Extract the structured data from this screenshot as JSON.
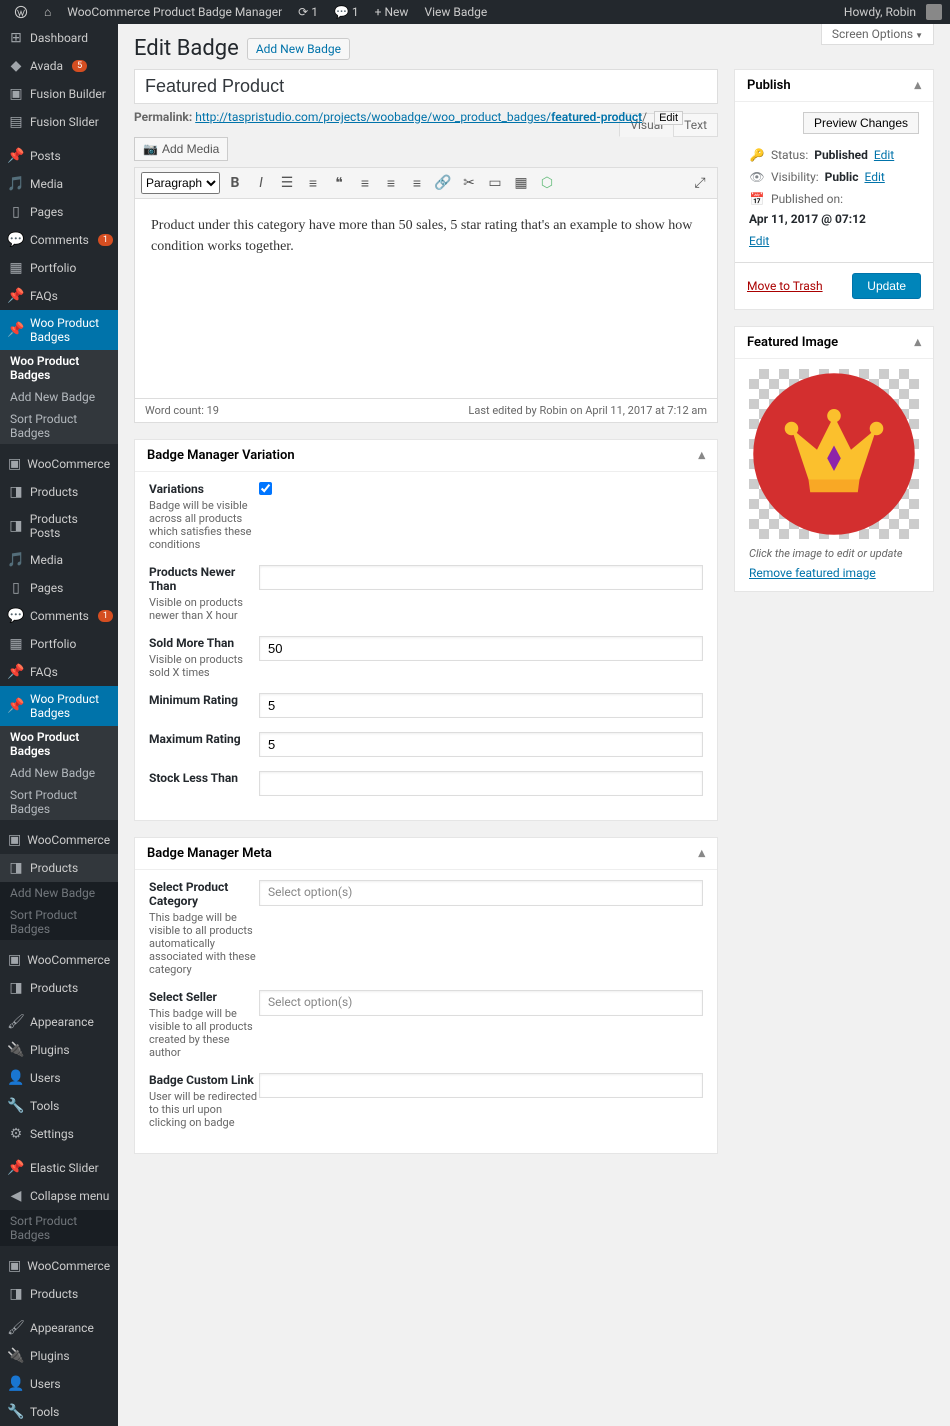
{
  "adminbar": {
    "site": "WooCommerce Product Badge Manager",
    "refresh": "1",
    "comments": "1",
    "new": "New",
    "view": "View Badge",
    "howdy": "Howdy, Robin"
  },
  "menu": {
    "dashboard": "Dashboard",
    "avada": "Avada",
    "avada_badge": "5",
    "fusion_builder": "Fusion Builder",
    "fusion_slider": "Fusion Slider",
    "posts": "Posts",
    "media": "Media",
    "pages": "Pages",
    "comments": "Comments",
    "comments_badge": "1",
    "portfolio": "Portfolio",
    "faqs": "FAQs",
    "woo_badges": "Woo Product Badges",
    "sub_all": "Woo Product Badges",
    "sub_add": "Add New Badge",
    "sub_sort": "Sort Product Badges",
    "woocommerce": "WooCommerce",
    "products": "Products",
    "products_posts": "Products Posts",
    "media2": "Media",
    "pages2": "Pages",
    "comments2": "Comments",
    "comments2_badge": "1",
    "portfolio2": "Portfolio",
    "faqs2": "FAQs",
    "appearance": "Appearance",
    "plugins": "Plugins",
    "users": "Users",
    "tools": "Tools",
    "settings": "Settings",
    "elastic_slider": "Elastic Slider",
    "collapse": "Collapse menu"
  },
  "screen_options": "Screen Options",
  "page": {
    "heading": "Edit Badge",
    "add_new": "Add New Badge"
  },
  "title_value": "Featured Product",
  "permalink": {
    "label": "Permalink:",
    "base": "http://taspristudio.com/projects/woobadge/woo_product_badges/",
    "slug": "featured-product",
    "edit": "Edit"
  },
  "add_media": "Add Media",
  "tabs": {
    "visual": "Visual",
    "text": "Text"
  },
  "format_select": "Paragraph",
  "editor_body": "Product under this category have more than 50 sales, 5 star rating that's an example to show how condition works together.",
  "editor_footer": {
    "wc": "Word count: 19",
    "last": "Last edited by Robin on April 11, 2017 at 7:12 am"
  },
  "box_variation": {
    "title": "Badge Manager Variation",
    "variations_label": "Variations",
    "variations_desc": "Badge will be visible across all products which satisfies these conditions",
    "newer_label": "Products Newer Than",
    "newer_desc": "Visible on products newer than X hour",
    "newer_value": "",
    "sold_label": "Sold More Than",
    "sold_desc": "Visible on products sold X times",
    "sold_value": "50",
    "min_label": "Minimum Rating",
    "min_value": "5",
    "max_label": "Maximum Rating",
    "max_value": "5",
    "stock_label": "Stock Less Than",
    "stock_value": ""
  },
  "box_meta": {
    "title": "Badge Manager Meta",
    "cat_label": "Select Product Category",
    "cat_desc": "This badge will be visible to all products automatically associated with these category",
    "seller_label": "Select Seller",
    "seller_desc": "This badge will be visible to all products created by these author",
    "link_label": "Badge Custom Link",
    "link_desc": "User will be redirected to this url upon clicking on badge",
    "select_placeholder": "Select option(s)"
  },
  "publish": {
    "title": "Publish",
    "preview": "Preview Changes",
    "status_label": "Status:",
    "status_value": "Published",
    "status_edit": "Edit",
    "vis_label": "Visibility:",
    "vis_value": "Public",
    "vis_edit": "Edit",
    "pub_label": "Published on:",
    "pub_value": "Apr 11, 2017 @ 07:12",
    "pub_edit": "Edit",
    "trash": "Move to Trash",
    "update": "Update"
  },
  "featured": {
    "title": "Featured Image",
    "hint": "Click the image to edit or update",
    "remove": "Remove featured image"
  }
}
